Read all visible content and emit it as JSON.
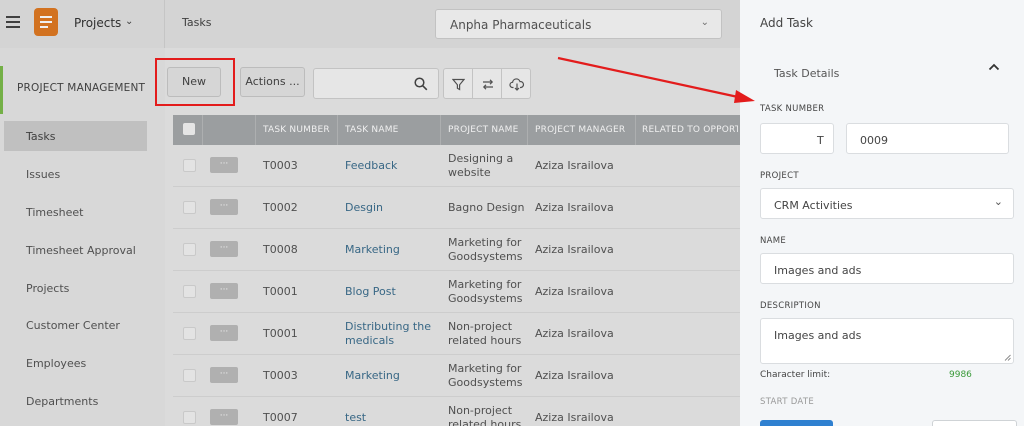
{
  "header": {
    "module_title": "Projects",
    "breadcrumb": "Tasks",
    "company": "Anpha Pharmaceuticals"
  },
  "sidebar": {
    "section_title": "PROJECT MANAGEMENT",
    "items": [
      {
        "label": "Tasks",
        "active": true
      },
      {
        "label": "Issues"
      },
      {
        "label": "Timesheet"
      },
      {
        "label": "Timesheet Approval"
      },
      {
        "label": "Projects"
      },
      {
        "label": "Customer Center"
      },
      {
        "label": "Employees"
      },
      {
        "label": "Departments"
      }
    ]
  },
  "toolbar": {
    "new_label": "New",
    "actions_label": "Actions ..."
  },
  "grid": {
    "columns": [
      "TASK NUMBER",
      "TASK NAME",
      "PROJECT NAME",
      "PROJECT MANAGER",
      "RELATED TO OPPORTUN"
    ],
    "row_menu": "···",
    "rows": [
      {
        "number": "T0003",
        "name": "Feedback",
        "project_l1": "Designing a",
        "project_l2": "website",
        "manager": "Aziza Israilova"
      },
      {
        "number": "T0002",
        "name": "Desgin",
        "project_l1": "Bagno Design",
        "project_l2": "",
        "manager": "Aziza Israilova"
      },
      {
        "number": "T0008",
        "name": "Marketing",
        "project_l1": "Marketing for",
        "project_l2": "Goodsystems",
        "manager": "Aziza Israilova"
      },
      {
        "number": "T0001",
        "name": "Blog Post",
        "project_l1": "Marketing for",
        "project_l2": "Goodsystems",
        "manager": "Aziza Israilova"
      },
      {
        "number": "T0001",
        "name": "Distributing the medicals",
        "project_l1": "Non-project",
        "project_l2": "related hours",
        "manager": "Aziza Israilova"
      },
      {
        "number": "T0003",
        "name": "Marketing",
        "project_l1": "Marketing for",
        "project_l2": "Goodsystems",
        "manager": "Aziza Israilova"
      },
      {
        "number": "T0007",
        "name": "test",
        "project_l1": "Non-project",
        "project_l2": "related hours",
        "manager": "Aziza Israilova"
      }
    ]
  },
  "panel": {
    "title": "Add Task",
    "section": "Task Details",
    "task_number_label": "TASK NUMBER",
    "task_prefix": "T",
    "task_number": "0009",
    "project_label": "PROJECT",
    "project_value": "CRM Activities",
    "name_label": "NAME",
    "name_value": "Images and ads",
    "description_label": "DESCRIPTION",
    "description_value": "Images and ads",
    "char_limit_label": "Character limit:",
    "char_limit_value": "9986",
    "start_date_label": "START DATE"
  },
  "colors": {
    "accent_green": "#7cbb4c",
    "annotation_red": "#e31c1c",
    "logo_orange": "#e07a22",
    "primary_blue": "#2f80d0",
    "link_blue": "#3c6e8e"
  },
  "icons": [
    "hamburger-icon",
    "app-logo-icon",
    "chevron-down-icon",
    "search-icon",
    "filter-icon",
    "refresh-icon",
    "cloud-download-icon",
    "chevron-up-icon"
  ]
}
